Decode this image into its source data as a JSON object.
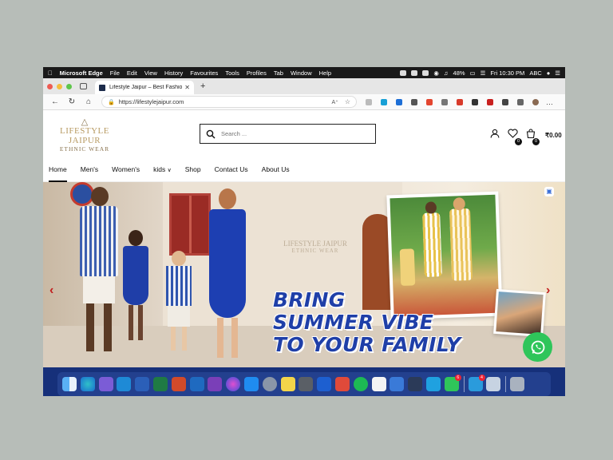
{
  "menubar": {
    "app": "Microsoft Edge",
    "items": [
      "File",
      "Edit",
      "View",
      "History",
      "Favourites",
      "Tools",
      "Profiles",
      "Tab",
      "Window",
      "Help"
    ],
    "battery": "48%",
    "clock": "Fri 10:30 PM",
    "input_source": "ABC"
  },
  "browser": {
    "tab_title": "Lifestyle Jaipur – Best Fashion",
    "url": "https://lifestylejaipur.com"
  },
  "site": {
    "logo_line1": "LIFESTYLE JAIPUR",
    "logo_line2": "ETHNIC WEAR",
    "search_placeholder": "Search ...",
    "wishlist_count": "0",
    "cart_count": "0",
    "cart_total": "₹0.00",
    "nav": [
      "Home",
      "Men's",
      "Women's",
      "kids",
      "Shop",
      "Contact Us",
      "About Us"
    ],
    "hero": {
      "watermark_line1": "LIFESTYLE JAIPUR",
      "watermark_line2": "ETHNIC WEAR",
      "headline": [
        "BRING",
        "SUMMER VIBE",
        "TO YOUR FAMILY"
      ]
    }
  },
  "dock": {
    "whatsapp_badge": "6",
    "telegram_badge": "4"
  },
  "colors": {
    "brand_gold": "#b89b63",
    "headline_blue": "#1f3fa8",
    "arrow_red": "#c21d1d",
    "whatsapp_green": "#2fc55a"
  }
}
